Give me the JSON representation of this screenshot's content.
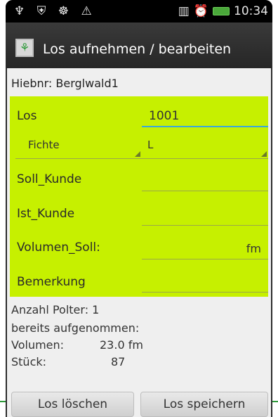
{
  "status": {
    "left_icons": "♆ ⛨ ☸ ⚠",
    "time": "10:34"
  },
  "header": {
    "icon": "tree-icon",
    "title": "Los aufnehmen / bearbeiten"
  },
  "form": {
    "hiebnr": "Hiebnr: Berglwald1",
    "los_label": "Los",
    "los_value": "1001",
    "species_spinner": "Fichte",
    "class_spinner": "L",
    "soll_kunde_label": "Soll_Kunde",
    "ist_kunde_label": "Ist_Kunde",
    "volumen_soll_label": "Volumen_Soll:",
    "volumen_soll_unit": "fm",
    "bemerkung_label": "Bemerkung"
  },
  "info": {
    "anzahl_polter": "Anzahl Polter: 1",
    "bereits": "bereits aufgenommen:",
    "volumen_label": "Volumen:",
    "volumen_value": "23.0 fm",
    "stueck_label": "Stück:",
    "stueck_value": "87"
  },
  "buttons": {
    "delete": "Los löschen",
    "save": "Los speichern"
  },
  "colors": {
    "form_background": "#c6f000",
    "accent_line": "#2e9a3a",
    "focus": "#3aa8d8"
  }
}
